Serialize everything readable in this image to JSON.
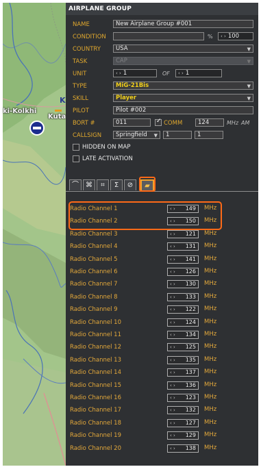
{
  "map": {
    "labels": {
      "kolkhi": "ki-Kolkhi",
      "kuta": "Kuta",
      "k": "K"
    }
  },
  "panel": {
    "title": "AIRPLANE GROUP",
    "name": {
      "label": "NAME",
      "value": "New Airplane Group #001"
    },
    "condition": {
      "label": "CONDITION",
      "value": "",
      "unit": "%",
      "stepper_value": "100"
    },
    "country": {
      "label": "COUNTRY",
      "value": "USA"
    },
    "task": {
      "label": "TASK",
      "value": "CAP"
    },
    "unit": {
      "label": "UNIT",
      "value": "1",
      "of_label": "OF",
      "of_value": "1"
    },
    "type": {
      "label": "TYPE",
      "value": "MiG-21Bis"
    },
    "skill": {
      "label": "SKILL",
      "value": "Player"
    },
    "pilot": {
      "label": "PILOT",
      "value": "Pilot #002"
    },
    "bort": {
      "label": "BORT #",
      "value": "011"
    },
    "comm": {
      "label": "COMM",
      "value": "124",
      "unit1": "MHz",
      "unit2": "AM",
      "checked": true
    },
    "callsign": {
      "label": "CALLSIGN",
      "value": "Springfield",
      "n1": "1",
      "n2": "1"
    },
    "hidden_on_map": {
      "label": "HIDDEN ON MAP",
      "checked": false
    },
    "late_activation": {
      "label": "LATE ACTIVATION",
      "checked": false
    },
    "tabs": [
      {
        "icon": "route-icon",
        "glyph": "⌒"
      },
      {
        "icon": "target-icon",
        "glyph": "⌘"
      },
      {
        "icon": "payload-icon",
        "glyph": "⌗"
      },
      {
        "icon": "summary-icon",
        "glyph": "Σ"
      },
      {
        "icon": "failures-icon",
        "glyph": "⊘"
      },
      {
        "icon": "radio-icon",
        "glyph": "▰"
      }
    ],
    "channels": [
      {
        "label": "Radio Channel 1",
        "value": "149",
        "unit": "MHz"
      },
      {
        "label": "Radio Channel 2",
        "value": "150",
        "unit": "MHz"
      },
      {
        "label": "Radio Channel 3",
        "value": "121",
        "unit": "MHz"
      },
      {
        "label": "Radio Channel 4",
        "value": "131",
        "unit": "MHz"
      },
      {
        "label": "Radio Channel 5",
        "value": "141",
        "unit": "MHz"
      },
      {
        "label": "Radio Channel 6",
        "value": "126",
        "unit": "MHz"
      },
      {
        "label": "Radio Channel 7",
        "value": "130",
        "unit": "MHz"
      },
      {
        "label": "Radio Channel 8",
        "value": "133",
        "unit": "MHz"
      },
      {
        "label": "Radio Channel 9",
        "value": "122",
        "unit": "MHz"
      },
      {
        "label": "Radio Channel 10",
        "value": "124",
        "unit": "MHz"
      },
      {
        "label": "Radio Channel 11",
        "value": "134",
        "unit": "MHz"
      },
      {
        "label": "Radio Channel 12",
        "value": "125",
        "unit": "MHz"
      },
      {
        "label": "Radio Channel 13",
        "value": "135",
        "unit": "MHz"
      },
      {
        "label": "Radio Channel 14",
        "value": "137",
        "unit": "MHz"
      },
      {
        "label": "Radio Channel 15",
        "value": "136",
        "unit": "MHz"
      },
      {
        "label": "Radio Channel 16",
        "value": "123",
        "unit": "MHz"
      },
      {
        "label": "Radio Channel 17",
        "value": "132",
        "unit": "MHz"
      },
      {
        "label": "Radio Channel 18",
        "value": "127",
        "unit": "MHz"
      },
      {
        "label": "Radio Channel 19",
        "value": "129",
        "unit": "MHz"
      },
      {
        "label": "Radio Channel 20",
        "value": "138",
        "unit": "MHz"
      }
    ],
    "colors": {
      "panel_bg": "#2e3033",
      "label": "#e0a82e",
      "highlight": "#ff6a17",
      "type_text": "#f1cf1a"
    }
  }
}
